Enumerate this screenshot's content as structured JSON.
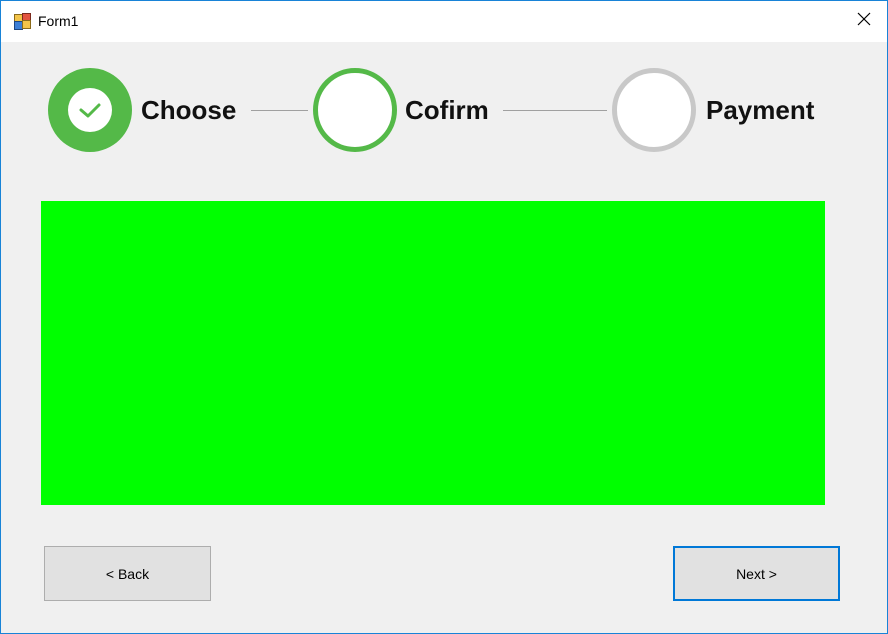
{
  "window": {
    "title": "Form1",
    "app_icon": "winforms-app-icon",
    "close_icon": "close-icon"
  },
  "steps": [
    {
      "label": "Choose",
      "state": "completed",
      "icon": "checkmark-icon"
    },
    {
      "label": "Cofirm",
      "state": "active"
    },
    {
      "label": "Payment",
      "state": "pending"
    }
  ],
  "colors": {
    "step_complete": "#54b948",
    "step_pending": "#c8c8c8",
    "content_panel": "#00ff00",
    "focus_border": "#0078d7"
  },
  "buttons": {
    "back_label": "< Back",
    "next_label": "Next >"
  }
}
